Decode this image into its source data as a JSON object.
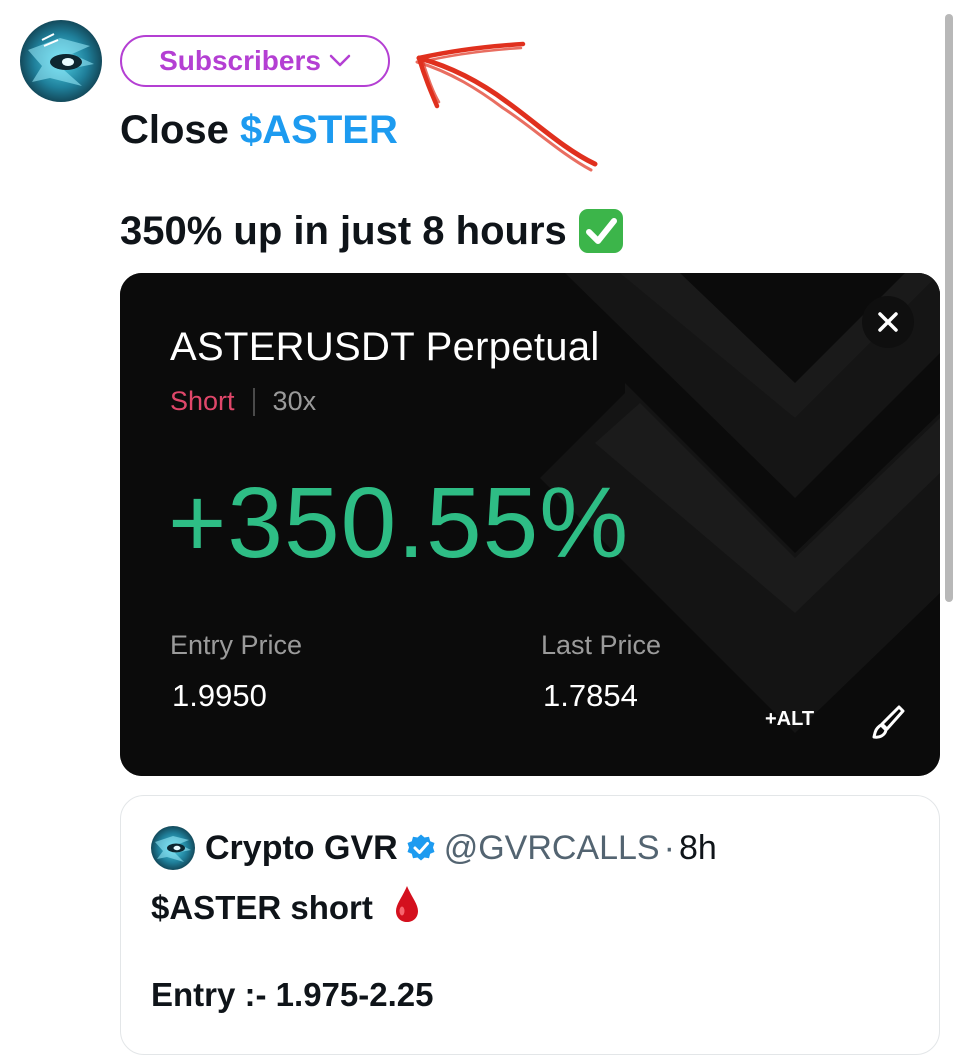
{
  "post": {
    "audience_label": "Subscribers",
    "text_line1_prefix": "Close ",
    "text_line1_cashtag": "$ASTER",
    "text_line2": "350% up in just 8 hours",
    "check_emoji_name": "check-mark-icon"
  },
  "media_card": {
    "pair": "ASTERUSDT Perpetual",
    "side": "Short",
    "leverage": "30x",
    "pnl": "+350.55%",
    "entry_label": "Entry Price",
    "entry_value": "1.9950",
    "last_label": "Last Price",
    "last_value": "1.7854",
    "alt_button": "+ALT",
    "colors": {
      "background": "#0b0b0b",
      "pnl": "#2ebd85",
      "short": "#e0476a"
    }
  },
  "quoted_post": {
    "author_name": "Crypto GVR",
    "handle": "@GVRCALLS",
    "separator": "·",
    "time": "8h",
    "line1": "$ASTER short",
    "line2": "Entry :- 1.975-2.25"
  },
  "colors": {
    "accent_blue": "#1d9bf0",
    "subscribers_purple": "#b43fd3",
    "annotation_red": "#e0301e"
  }
}
